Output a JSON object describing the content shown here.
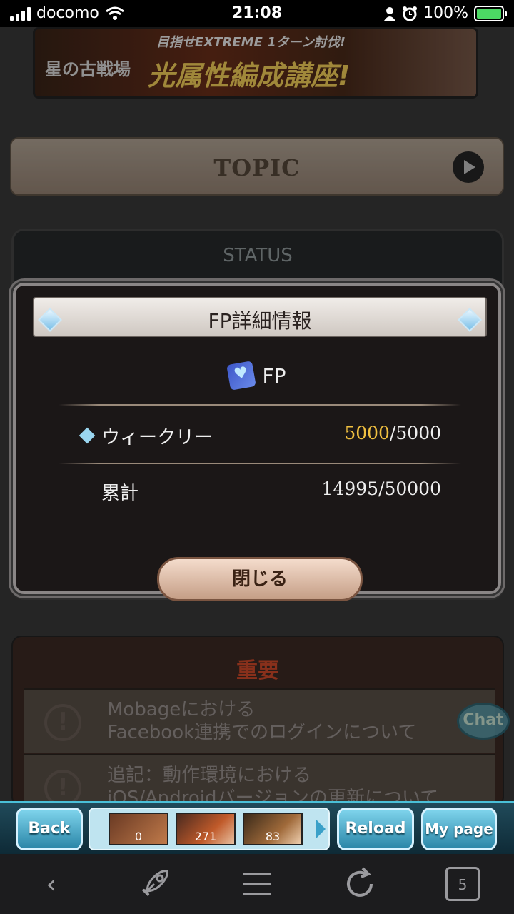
{
  "status_bar": {
    "carrier": "docomo",
    "time": "21:08",
    "battery": "100%",
    "icons": [
      "signal-icon",
      "wifi-icon",
      "person-icon",
      "alarm-icon",
      "battery-charging-icon"
    ]
  },
  "banner": {
    "left_small": "星の古戦場",
    "subtitle": "目指せEXTREME 1ターン討伐!",
    "title": "光属性編成講座!"
  },
  "topic": {
    "label": "TOPIC"
  },
  "status_panel": {
    "title": "STATUS"
  },
  "modal": {
    "title": "FP詳細情報",
    "fp_label": "FP",
    "weekly": {
      "label": "ウィークリー",
      "current": "5000",
      "max": "/5000"
    },
    "total": {
      "label": "累計",
      "value": "14995/50000"
    },
    "close_label": "閉じる"
  },
  "important": {
    "heading": "重要",
    "items": [
      {
        "line1": "Mobageにおける",
        "line2": "Facebook連携でのログインについて"
      },
      {
        "line1": "追記：動作環境における",
        "line2": "iOS/Androidバージョンの更新について"
      }
    ]
  },
  "chat_label": "Chat",
  "game_bar": {
    "back": "Back",
    "reload": "Reload",
    "mypage": "My page",
    "thumbs": [
      "0",
      "271",
      "83"
    ]
  },
  "browser": {
    "tab_count": "5"
  }
}
